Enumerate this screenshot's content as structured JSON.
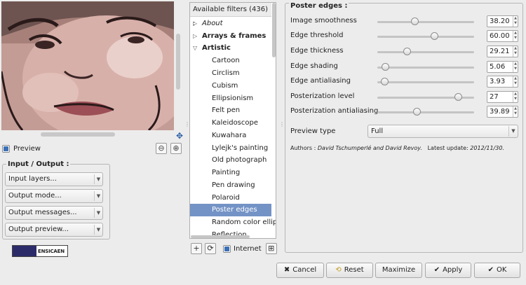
{
  "preview": {
    "checkbox_label": "Preview",
    "checked": true,
    "zoom_out_glyph": "⊖",
    "zoom_in_glyph": "⊕"
  },
  "io": {
    "title": "Input / Output :",
    "combos": [
      "Input layers...",
      "Output mode...",
      "Output messages...",
      "Output preview..."
    ]
  },
  "logo": {
    "text": "ENSICAEN"
  },
  "tree": {
    "header": "Available filters (436) :",
    "categories": [
      {
        "label": "About",
        "italic": true,
        "expanded": false
      },
      {
        "label": "Arrays & frames",
        "bold": true,
        "expanded": false
      },
      {
        "label": "Artistic",
        "bold": true,
        "expanded": true
      }
    ],
    "leaves": [
      "Cartoon",
      "Circlism",
      "Cubism",
      "Ellipsionism",
      "Felt pen",
      "Kaleidoscope",
      "Kuwahara",
      "Lylejk's painting",
      "Old photograph",
      "Painting",
      "Pen drawing",
      "Polaroid",
      "Poster edges",
      "Random color ellipses",
      "Reflection"
    ],
    "selected": "Poster edges",
    "tools": {
      "add": "+",
      "refresh": "⟳",
      "internet_label": "Internet",
      "internet_checked": true,
      "expand": "⊞"
    }
  },
  "params": {
    "title": "Poster edges :",
    "sliders": [
      {
        "label": "Image smoothness",
        "value": "38.20",
        "fraction": 0.38
      },
      {
        "label": "Edge threshold",
        "value": "60.00",
        "fraction": 0.6
      },
      {
        "label": "Edge thickness",
        "value": "29.21",
        "fraction": 0.29
      },
      {
        "label": "Edge shading",
        "value": "5.06",
        "fraction": 0.05
      },
      {
        "label": "Edge antialiasing",
        "value": "3.93",
        "fraction": 0.04
      },
      {
        "label": "Posterization level",
        "value": "27",
        "fraction": 0.87
      },
      {
        "label": "Posterization antialiasing",
        "value": "39.89",
        "fraction": 0.4
      }
    ],
    "preview_type_label": "Preview type",
    "preview_type_value": "Full",
    "authors_prefix": "Authors :",
    "authors": "David Tschumperlé and David Revoy.",
    "update_prefix": "Latest update:",
    "update_date": "2012/11/30."
  },
  "buttons": {
    "cancel": "Cancel",
    "reset": "Reset",
    "maximize": "Maximize",
    "apply": "Apply",
    "ok": "OK"
  },
  "colors": {
    "selection": "#7393c6",
    "accent": "#3b6fb6"
  }
}
